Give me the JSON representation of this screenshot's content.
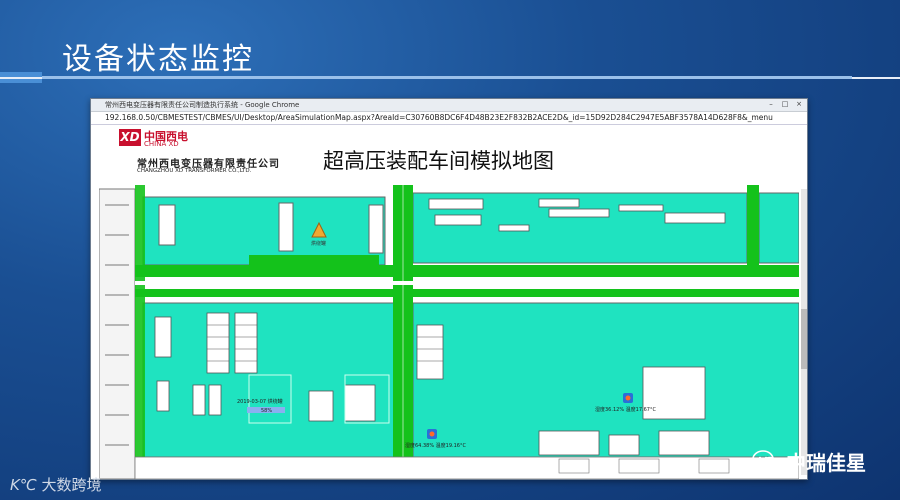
{
  "slide": {
    "title": "设备状态监控"
  },
  "browser": {
    "window_title": "常州西电变压器有限责任公司制造执行系统 - Google Chrome",
    "url": "192.168.0.50/CBMESTEST/CBMES/UI/Desktop/AreaSimulationMap.aspx?AreaId=C30760B8DC6F4D48B23E2F832B2ACE2D&_id=15D92D284C2947E5ABF3578A14D628F8&_menu"
  },
  "company": {
    "logo_mark": "XD",
    "logo_cn": "中国西电",
    "logo_en": "CHINA XD",
    "name_cn": "常州西电变压器有限责任公司",
    "name_en": "CHANGZHOU XD TRANSFORMER CO.,LTD."
  },
  "map": {
    "title": "超高压装配车间模拟地图",
    "equipment_label": "烘绕罐",
    "readout_1_time": "2019-03-07 烘绕罐",
    "readout_1_value": "58%",
    "readout_2": "湿度64.38% 温度19.16°C",
    "readout_3": "湿度36.12% 温度17.67°C",
    "colors": {
      "zone": "#1fe3c0",
      "corridor": "#14c21b",
      "wall": "#6a6a6a"
    }
  },
  "footer": {
    "watermark": "大数跨境",
    "wechat_label": "中瑞佳星"
  }
}
